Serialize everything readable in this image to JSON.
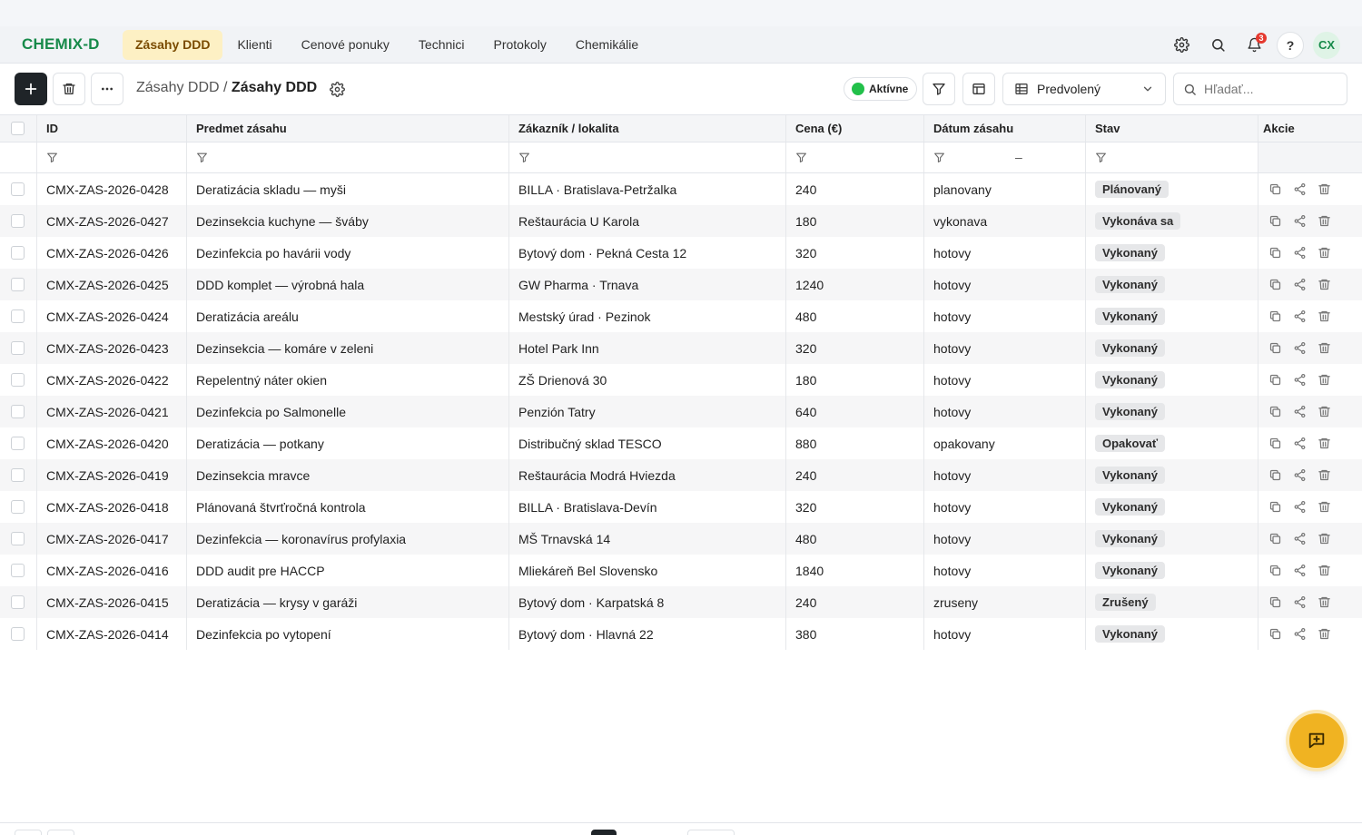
{
  "app": {
    "brand": "CHEMIX-D"
  },
  "nav": {
    "items": [
      {
        "label": "Zásahy DDD",
        "active": true
      },
      {
        "label": "Klienti",
        "active": false
      },
      {
        "label": "Cenové ponuky",
        "active": false
      },
      {
        "label": "Technici",
        "active": false
      },
      {
        "label": "Protokoly",
        "active": false
      },
      {
        "label": "Chemikálie",
        "active": false
      }
    ],
    "notifications_count": "3",
    "help_label": "?",
    "avatar_initials": "CX",
    "icons": [
      "gear-icon",
      "search-icon",
      "bell-icon"
    ]
  },
  "toolbar": {
    "breadcrumb_parent": "Zásahy DDD",
    "breadcrumb_sep": " / ",
    "breadcrumb_current": "Zásahy DDD",
    "status_label": "Aktívne",
    "view_label": "Predvolený",
    "search_placeholder": "Hľadať..."
  },
  "table": {
    "columns": [
      "ID",
      "Predmet zásahu",
      "Zákazník / lokalita",
      "Cena (€)",
      "Dátum zásahu",
      "Stav",
      "Akcie"
    ],
    "date_filter_dash": "–",
    "rows": [
      {
        "id": "CMX-ZAS-2026-0428",
        "subject": "Deratizácia skladu — myši",
        "customer": "BILLA · Bratislava-Petržalka",
        "price": "240",
        "date": "planovany",
        "status": "Plánovaný"
      },
      {
        "id": "CMX-ZAS-2026-0427",
        "subject": "Dezinsekcia kuchyne — šváby",
        "customer": "Reštaurácia U Karola",
        "price": "180",
        "date": "vykonava",
        "status": "Vykonáva sa"
      },
      {
        "id": "CMX-ZAS-2026-0426",
        "subject": "Dezinfekcia po havárii vody",
        "customer": "Bytový dom · Pekná Cesta 12",
        "price": "320",
        "date": "hotovy",
        "status": "Vykonaný"
      },
      {
        "id": "CMX-ZAS-2026-0425",
        "subject": "DDD komplet — výrobná hala",
        "customer": "GW Pharma · Trnava",
        "price": "1240",
        "date": "hotovy",
        "status": "Vykonaný"
      },
      {
        "id": "CMX-ZAS-2026-0424",
        "subject": "Deratizácia areálu",
        "customer": "Mestský úrad · Pezinok",
        "price": "480",
        "date": "hotovy",
        "status": "Vykonaný"
      },
      {
        "id": "CMX-ZAS-2026-0423",
        "subject": "Dezinsekcia — komáre v zeleni",
        "customer": "Hotel Park Inn",
        "price": "320",
        "date": "hotovy",
        "status": "Vykonaný"
      },
      {
        "id": "CMX-ZAS-2026-0422",
        "subject": "Repelentný náter okien",
        "customer": "ZŠ Drienová 30",
        "price": "180",
        "date": "hotovy",
        "status": "Vykonaný"
      },
      {
        "id": "CMX-ZAS-2026-0421",
        "subject": "Dezinfekcia po Salmonelle",
        "customer": "Penzión Tatry",
        "price": "640",
        "date": "hotovy",
        "status": "Vykonaný"
      },
      {
        "id": "CMX-ZAS-2026-0420",
        "subject": "Deratizácia — potkany",
        "customer": "Distribučný sklad TESCO",
        "price": "880",
        "date": "opakovany",
        "status": "Opakovať"
      },
      {
        "id": "CMX-ZAS-2026-0419",
        "subject": "Dezinsekcia mravce",
        "customer": "Reštaurácia Modrá Hviezda",
        "price": "240",
        "date": "hotovy",
        "status": "Vykonaný"
      },
      {
        "id": "CMX-ZAS-2026-0418",
        "subject": "Plánovaná štvrťročná kontrola",
        "customer": "BILLA · Bratislava-Devín",
        "price": "320",
        "date": "hotovy",
        "status": "Vykonaný"
      },
      {
        "id": "CMX-ZAS-2026-0417",
        "subject": "Dezinfekcia — koronavírus profylaxia",
        "customer": "MŠ Trnavská 14",
        "price": "480",
        "date": "hotovy",
        "status": "Vykonaný"
      },
      {
        "id": "CMX-ZAS-2026-0416",
        "subject": "DDD audit pre HACCP",
        "customer": "Mliekáreň Bel Slovensko",
        "price": "1840",
        "date": "hotovy",
        "status": "Vykonaný"
      },
      {
        "id": "CMX-ZAS-2026-0415",
        "subject": "Deratizácia — krysy v garáži",
        "customer": "Bytový dom · Karpatská 8",
        "price": "240",
        "date": "zruseny",
        "status": "Zrušený"
      },
      {
        "id": "CMX-ZAS-2026-0414",
        "subject": "Dezinfekcia po vytopení",
        "customer": "Bytový dom · Hlavná 22",
        "price": "380",
        "date": "hotovy",
        "status": "Vykonaný"
      }
    ],
    "row_action_icons": [
      "copy-icon",
      "share-icon",
      "trash-icon"
    ]
  },
  "colors": {
    "brand": "#178a4a",
    "active_nav_bg": "#fdf0c4",
    "primary_button": "#1f2428",
    "status_active": "#22c04a",
    "fab": "#f0b322",
    "notification": "#e5392f"
  }
}
